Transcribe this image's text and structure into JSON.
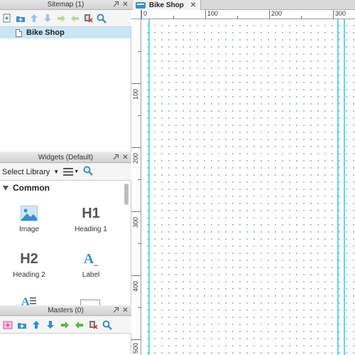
{
  "sitemap": {
    "title": "Sitemap (1)",
    "toolbar_icons": [
      "add-page-icon",
      "add-folder-icon",
      "move-up-icon",
      "move-down-icon",
      "indent-icon",
      "outdent-icon",
      "delete-icon",
      "search-icon"
    ],
    "items": [
      {
        "label": "Bike Shop",
        "selected": true
      }
    ]
  },
  "widgets": {
    "title": "Widgets (Default)",
    "library_label": "Select Library",
    "section": "Common",
    "items": [
      {
        "label": "Image",
        "icon": "image-icon"
      },
      {
        "label": "Heading 1",
        "glyph": "H1"
      },
      {
        "label": "Heading 2",
        "glyph": "H2"
      },
      {
        "label": "Label",
        "glyph": "A"
      }
    ]
  },
  "masters": {
    "title": "Masters (0)"
  },
  "editor": {
    "tab_label": "Bike Shop",
    "ruler_top": [
      "0",
      "100",
      "200",
      "300"
    ],
    "ruler_left": [
      "100",
      "200",
      "300",
      "400",
      "500"
    ]
  },
  "colors": {
    "selection": "#c9e6f5",
    "accent": "#3a8fc8",
    "guide": "#5fd6ee",
    "grid_dot": "#9aa9e8"
  }
}
